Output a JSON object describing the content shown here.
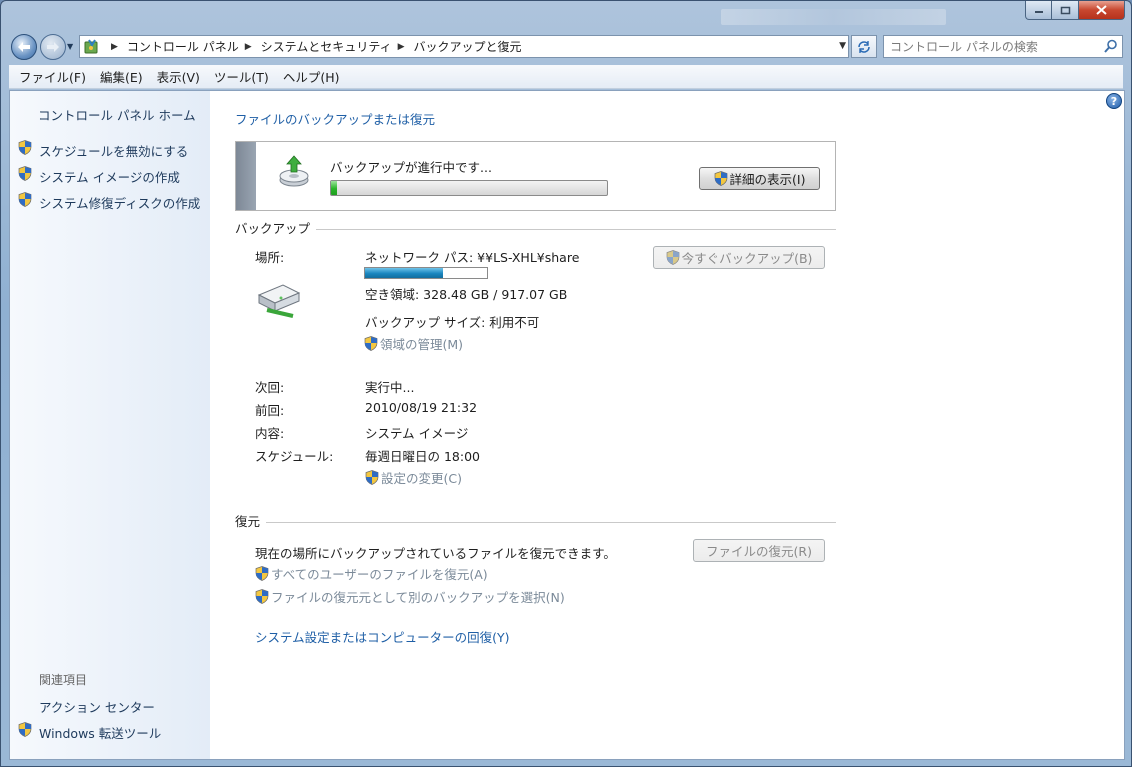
{
  "window": {
    "caption_buttons": {
      "minimize": "minimize-icon",
      "maximize": "maximize-icon",
      "close": "close-icon"
    }
  },
  "address_bar": {
    "crumbs": [
      "コントロール パネル",
      "システムとセキュリティ",
      "バックアップと復元"
    ],
    "search_placeholder": "コントロール パネルの検索"
  },
  "menu": [
    "ファイル(F)",
    "編集(E)",
    "表示(V)",
    "ツール(T)",
    "ヘルプ(H)"
  ],
  "sidebar": {
    "home": "コントロール パネル ホーム",
    "tasks": [
      "スケジュールを無効にする",
      "システム イメージの作成",
      "システム修復ディスクの作成"
    ],
    "related_heading": "関連項目",
    "related": [
      {
        "label": "アクション センター",
        "shield": false
      },
      {
        "label": "Windows 転送ツール",
        "shield": true
      }
    ]
  },
  "main": {
    "title": "ファイルのバックアップまたは復元",
    "status": {
      "text": "バックアップが進行中です...",
      "progress": 0.02,
      "details_button": "詳細の表示(I)"
    },
    "backup": {
      "heading": "バックアップ",
      "location_label": "場所:",
      "location_value": "ネットワーク パス: ¥¥LS-XHL¥share",
      "space_used_fraction": 0.64,
      "free_space": "空き領域: 328.48 GB / 917.07 GB",
      "backup_size": "バックアップ サイズ: 利用不可",
      "manage_space": "領域の管理(M)",
      "backup_now_button": "今すぐバックアップ(B)",
      "next_label": "次回:",
      "next_value": "実行中...",
      "last_label": "前回:",
      "last_value": "2010/08/19 21:32",
      "contents_label": "内容:",
      "contents_value": "システム イメージ",
      "schedule_label": "スケジュール:",
      "schedule_value": "毎週日曜日の 18:00",
      "change_settings": "設定の変更(C)"
    },
    "restore": {
      "heading": "復元",
      "description": "現在の場所にバックアップされているファイルを復元できます。",
      "restore_files_button": "ファイルの復元(R)",
      "restore_all_users": "すべてのユーザーのファイルを復元(A)",
      "select_other_backup": "ファイルの復元元として別のバックアップを選択(N)",
      "recover_system": "システム設定またはコンピューターの回復(Y)"
    }
  },
  "colors": {
    "link": "#1f5fa6",
    "progress": "#29b529",
    "space_fill": "#1a86bf"
  }
}
